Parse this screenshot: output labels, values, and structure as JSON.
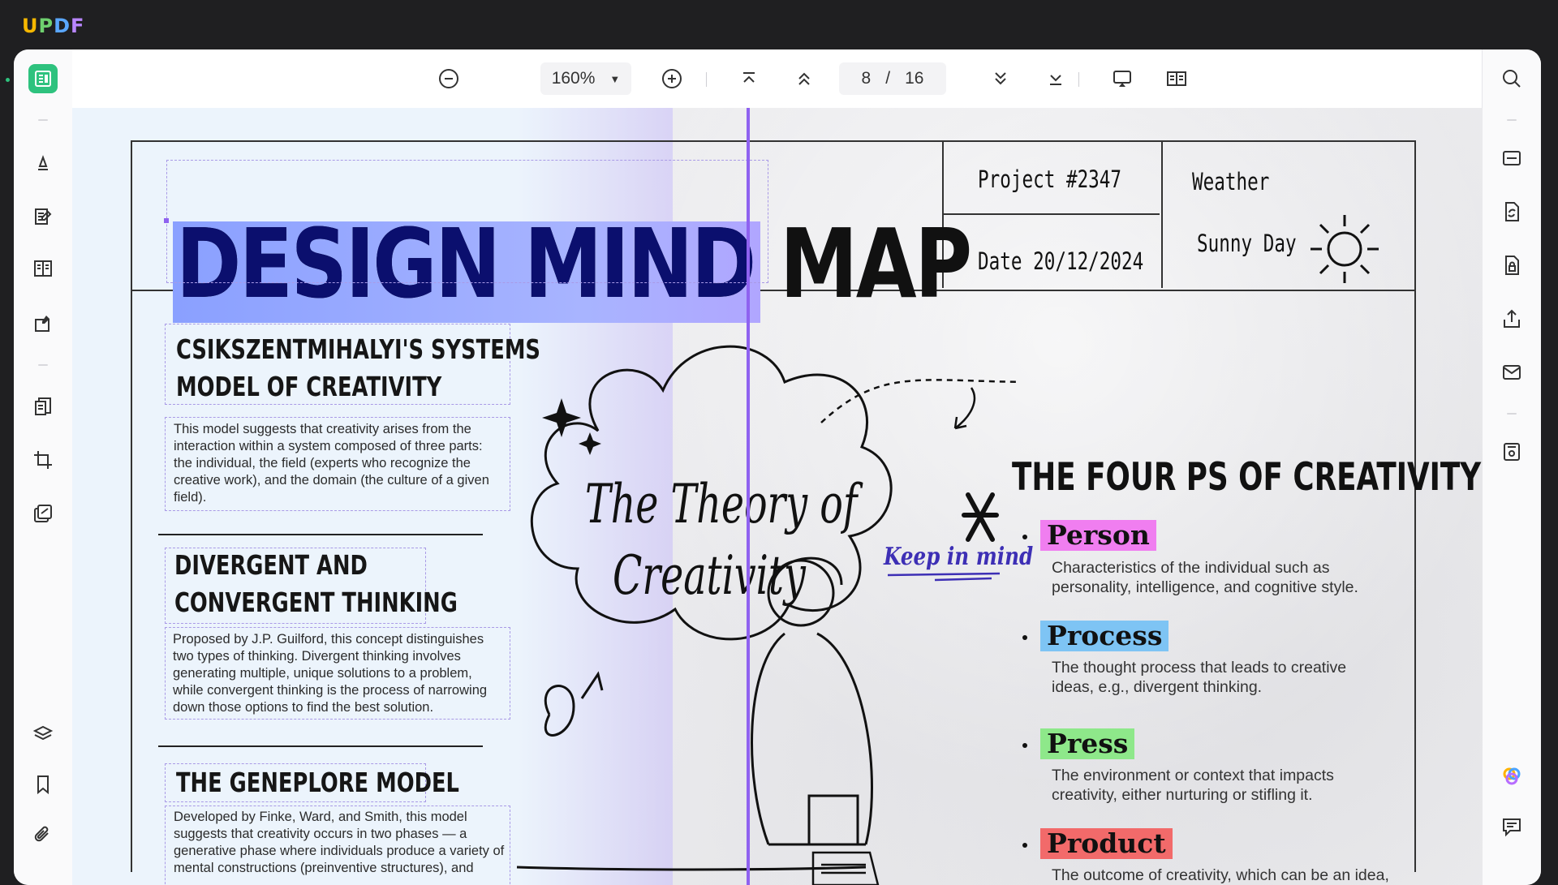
{
  "app": {
    "title_u": "U",
    "title_p": "P",
    "title_d": "D",
    "title_f": "F"
  },
  "toolbar": {
    "zoom": "160%",
    "page_current": "8",
    "page_sep": "/",
    "page_total": "16"
  },
  "document": {
    "title": "DESIGN MIND MAP",
    "project": "Project #2347",
    "date": "Date 20/12/2024",
    "weather_label": "Weather",
    "weather_value": "Sunny Day",
    "sections": [
      {
        "title_lines": [
          "CSIKSZENTMIHALYI'S SYSTEMS",
          "MODEL OF CREATIVITY"
        ],
        "body": "This model suggests that creativity arises from the interaction within a system composed of three parts: the individual, the field (experts who recognize the creative work), and the domain (the culture of a given field)."
      },
      {
        "title_lines": [
          "DIVERGENT AND",
          "CONVERGENT THINKING"
        ],
        "body": "Proposed by J.P. Guilford, this concept distinguishes two types of thinking. Divergent thinking involves generating multiple, unique solutions to a problem, while convergent thinking is the process of narrowing down those options to find the best solution."
      },
      {
        "title_lines": [
          "THE GENEPLORE MODEL"
        ],
        "body": "Developed by Finke, Ward, and Smith, this model suggests that creativity occurs in two phases — a generative phase where individuals produce a variety of mental constructions (preinventive structures), and"
      }
    ],
    "cloud_line1": "The Theory of",
    "cloud_line2": "Creativity",
    "keep_in_mind": "Keep in mind",
    "four_ps_title": "THE FOUR PS OF CREATIVITY",
    "four_ps": [
      {
        "tag": "Person",
        "color": "#f07ef0",
        "desc": "Characteristics of the individual such as personality, intelligence, and cognitive style."
      },
      {
        "tag": "Process",
        "color": "#7ec4f4",
        "desc": "The thought process that leads to creative ideas, e.g., divergent thinking."
      },
      {
        "tag": "Press",
        "color": "#8ee88a",
        "desc": "The environment or context that impacts creativity, either nurturing or stifling it."
      },
      {
        "tag": "Product",
        "color": "#f26a6a",
        "desc": "The outcome of creativity, which can be an idea, a solution, or an artwork."
      }
    ]
  },
  "icons": {
    "left": [
      "reader-icon",
      "highlighter-icon",
      "edit-text-icon",
      "organize-pages-icon",
      "fill-sign-icon",
      "convert-icon",
      "crop-icon",
      "batch-icon",
      "layers-icon",
      "bookmark-icon",
      "attachment-icon"
    ],
    "right": [
      "search-icon",
      "ocr-icon",
      "convert-file-icon",
      "protect-icon",
      "share-icon",
      "email-icon",
      "save-icon",
      "ai-assistant-icon",
      "comment-icon"
    ]
  }
}
